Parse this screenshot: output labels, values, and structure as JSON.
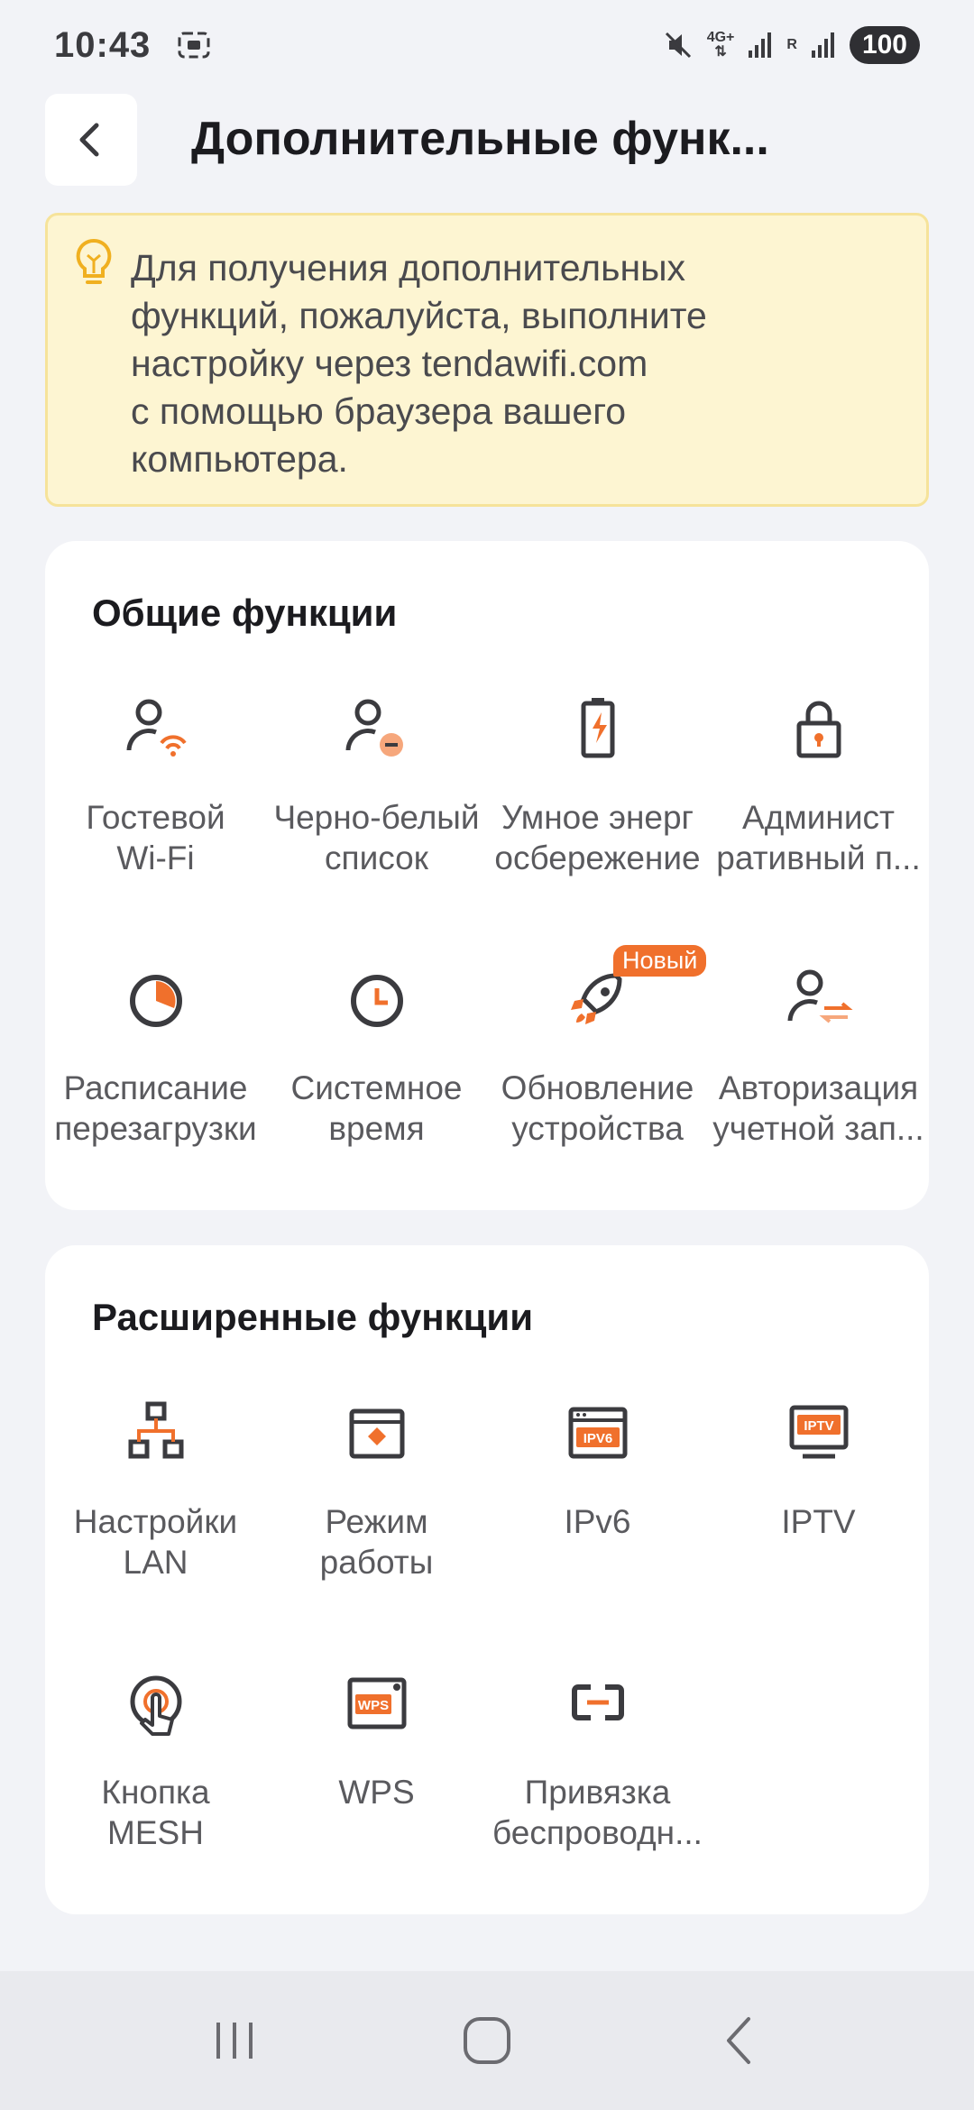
{
  "status_bar": {
    "time": "10:43",
    "battery": "100",
    "network": "4G+",
    "roaming": "R",
    "icons": [
      "screenshot-icon",
      "mute-icon",
      "signal-icon",
      "signal-icon"
    ]
  },
  "header": {
    "title": "Дополнительные функ...",
    "back_icon": "chevron-left-icon"
  },
  "notice": {
    "text": "Для получения дополнительных\nфункций, пожалуйста, выполните\nнастройку через tendawifi.com\nс помощью браузера вашего\nкомпьютера.",
    "icon": "lightbulb-icon"
  },
  "general": {
    "title": "Общие функции",
    "items": [
      {
        "label": "Гостевой\nWi-Fi",
        "icon": "guest-wifi-icon"
      },
      {
        "label": "Черно-белый\nсписок",
        "icon": "user-block-icon"
      },
      {
        "label": "Умное энерг\nосбережение",
        "icon": "battery-icon"
      },
      {
        "label": "Админист\nративный п...",
        "icon": "lock-icon"
      },
      {
        "label": "Расписание\nперезагрузки",
        "icon": "reboot-schedule-icon"
      },
      {
        "label": "Системное\nвремя",
        "icon": "clock-icon"
      },
      {
        "label": "Обновление\nустройства",
        "icon": "rocket-icon",
        "badge": "Новый"
      },
      {
        "label": "Авторизация\nучетной зап...",
        "icon": "user-auth-icon"
      }
    ]
  },
  "advanced": {
    "title": "Расширенные функции",
    "items": [
      {
        "label": "Настройки\nLAN",
        "icon": "lan-icon"
      },
      {
        "label": "Режим\nработы",
        "icon": "work-mode-icon"
      },
      {
        "label": "IPv6",
        "icon": "ipv6-icon",
        "icon_text": "IPV6"
      },
      {
        "label": "IPTV",
        "icon": "iptv-icon",
        "icon_text": "IPTV"
      },
      {
        "label": "Кнопка\nMESH",
        "icon": "mesh-button-icon"
      },
      {
        "label": "WPS",
        "icon": "wps-icon",
        "icon_text": "WPS"
      },
      {
        "label": "Привязка\nбеспроводн...",
        "icon": "link-icon"
      }
    ]
  },
  "nav": {
    "recent_icon": "recent-apps-icon",
    "home_icon": "home-icon",
    "back_icon": "back-icon"
  },
  "colors": {
    "accent": "#f0702c",
    "icon_dark": "#3b3b3f",
    "notice_bg": "#fdf5d2",
    "notice_border": "#f6e39a"
  }
}
